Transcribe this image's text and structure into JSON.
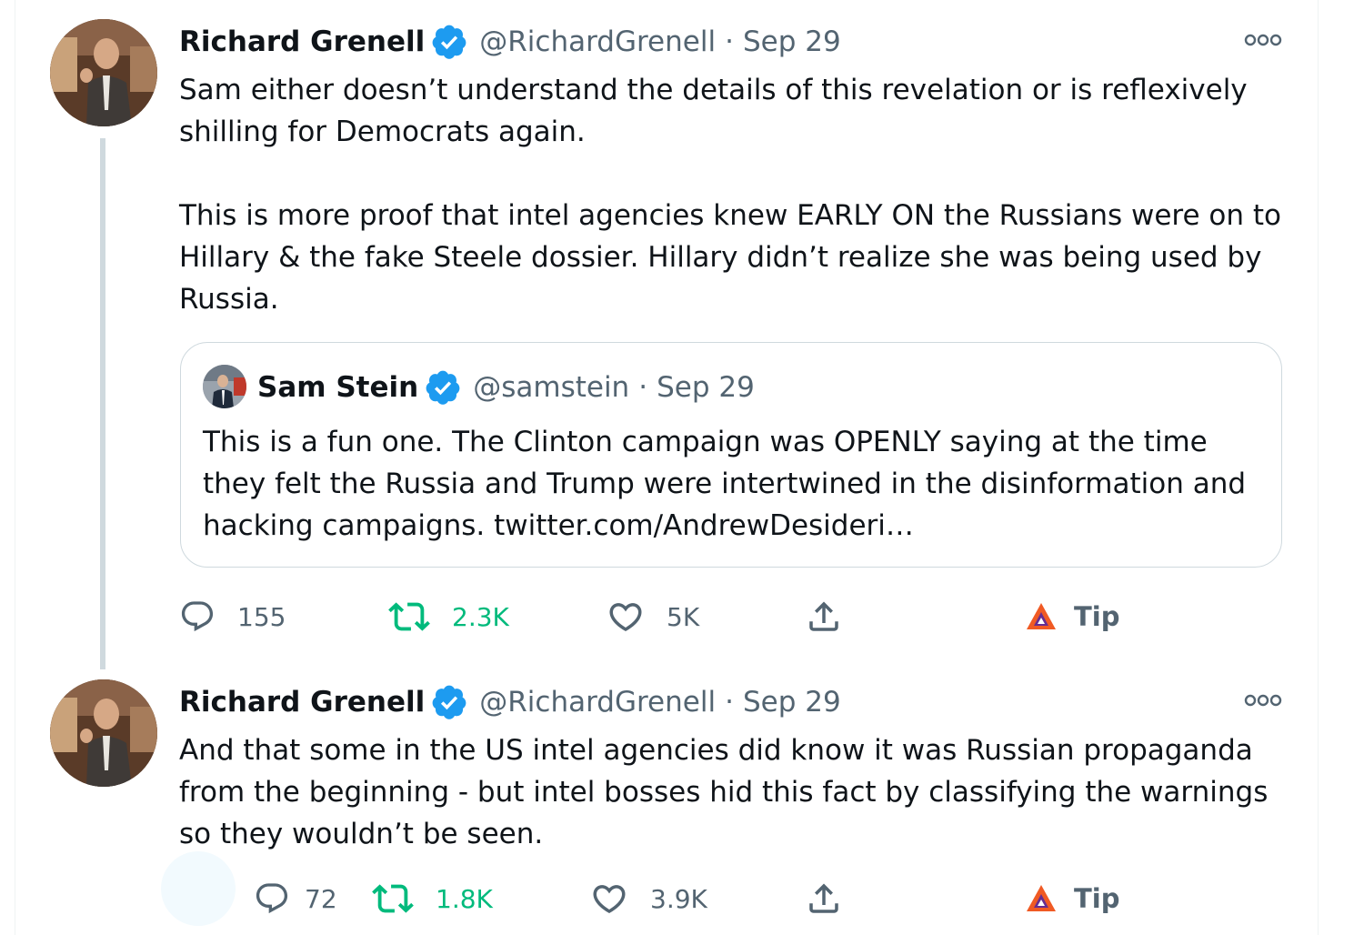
{
  "tweets": [
    {
      "author": {
        "name": "Richard Grenell",
        "handle": "@RichardGrenell",
        "verified_icon": "verified-badge-icon",
        "avatar": "avatar-richard-grenell"
      },
      "separator": "·",
      "date": "Sep 29",
      "text": "Sam either doesn’t understand the details of this revelation or is reflexively shilling for Democrats again.\n\nThis is more proof that intel agencies knew EARLY ON the Russians were on to Hillary & the fake Steele dossier. Hillary didn’t realize she was being used by Russia.",
      "quoted_tweet": {
        "author": {
          "name": "Sam Stein",
          "handle": "@samstein",
          "avatar": "avatar-sam-stein"
        },
        "separator": "·",
        "date": "Sep 29",
        "text": "This is a fun one. The Clinton campaign was OPENLY saying at the time they felt the Russia and Trump were intertwined in the disinformation and hacking campaigns. twitter.com/AndrewDesideri…"
      },
      "actions": {
        "reply_count": "155",
        "retweet_count": "2.3K",
        "like_count": "5K",
        "share_icon": "share-icon",
        "tip_label": "Tip"
      }
    },
    {
      "author": {
        "name": "Richard Grenell",
        "handle": "@RichardGrenell",
        "verified_icon": "verified-badge-icon",
        "avatar": "avatar-richard-grenell"
      },
      "separator": "·",
      "date": "Sep 29",
      "text": "And that some in the US intel agencies did know it was Russian propaganda from the beginning - but intel bosses hid this fact by classifying the warnings so they wouldn’t be seen.",
      "actions": {
        "reply_count": "72",
        "retweet_count": "1.8K",
        "like_count": "3.9K",
        "share_icon": "share-icon",
        "tip_label": "Tip"
      }
    }
  ],
  "colors": {
    "text_primary": "#0f1419",
    "text_secondary": "#536471",
    "verified_blue": "#1d9bf0",
    "retweet_green": "#00ba7c",
    "border": "#cfd9de",
    "thread_line": "#cfd9de",
    "tip_brave_orange": "#f05a24",
    "tip_brave_purple": "#662d91"
  }
}
